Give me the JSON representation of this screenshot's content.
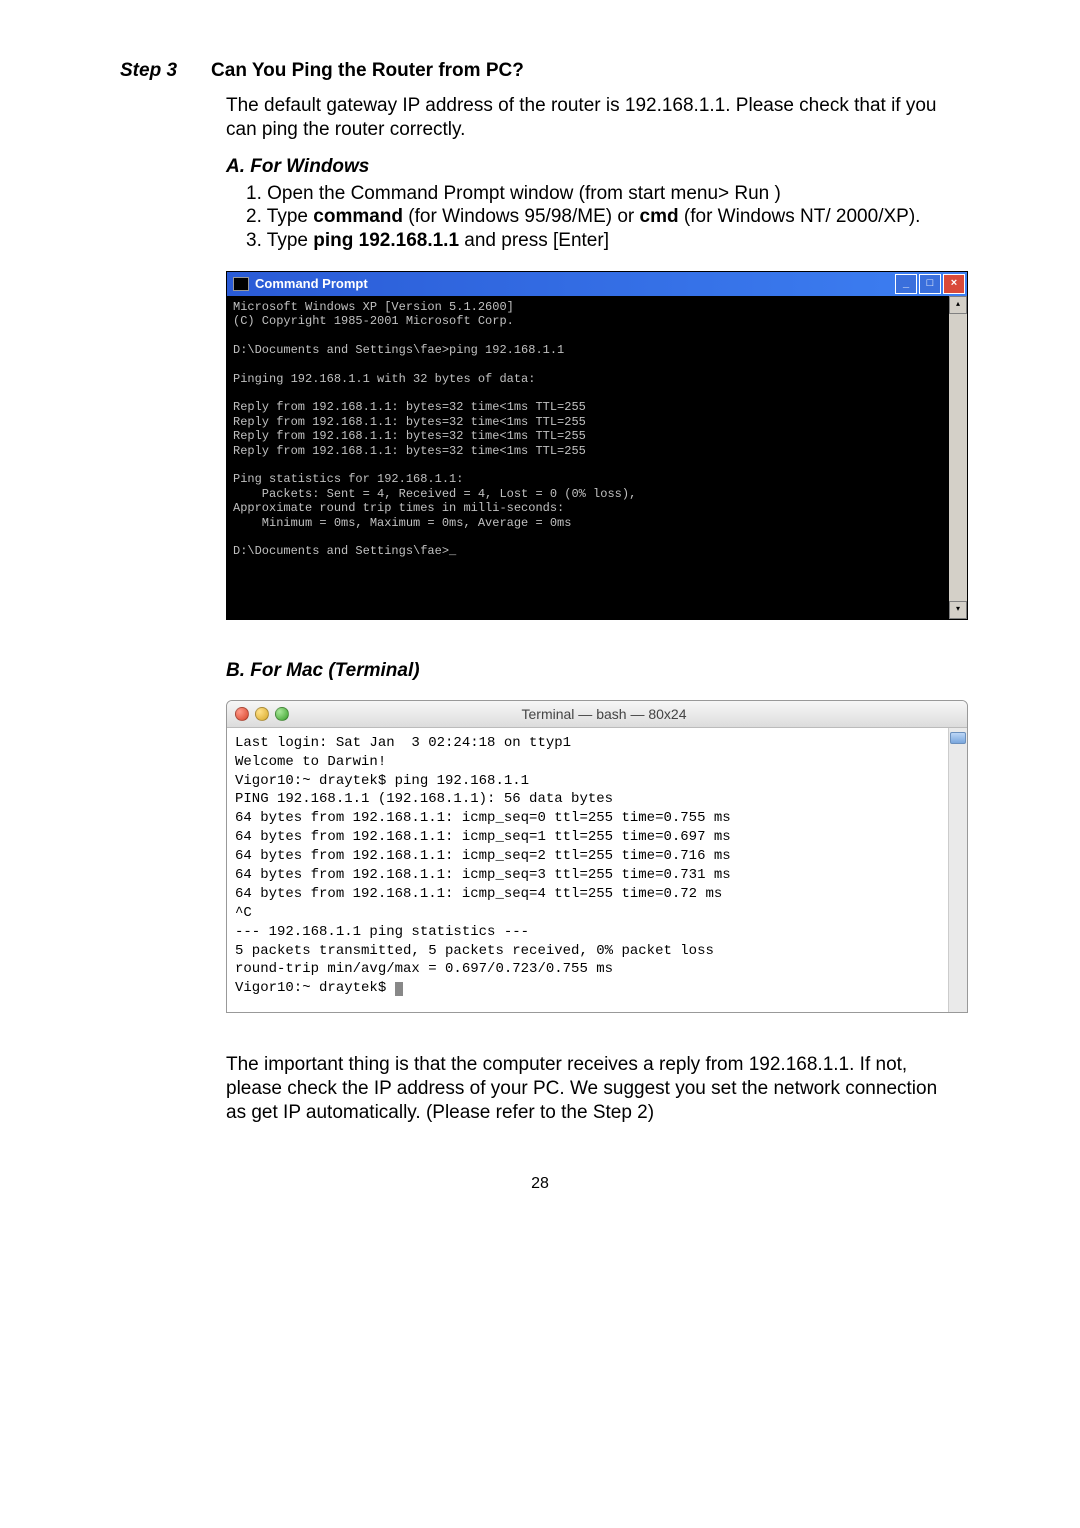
{
  "step_label": "Step 3",
  "step_heading": "Can You Ping the Router from PC?",
  "intro": "The default gateway IP address of the router is 192.168.1.1. Please check that if you can ping the router correctly.",
  "sectionA_title": "A. For Windows",
  "listA": {
    "l1": "1. Open the Command Prompt window (from start menu> Run )",
    "l2a": "2. Type ",
    "l2b": "command",
    "l2c": " (for Windows 95/98/ME) or ",
    "l2d": "cmd",
    "l2e": " (for Windows NT/ 2000/XP).",
    "l3a": "3. Type ",
    "l3b": "ping 192.168.1.1",
    "l3c": " and press [Enter]"
  },
  "win": {
    "title": "Command Prompt",
    "min": "_",
    "max": "□",
    "close": "×",
    "body": "Microsoft Windows XP [Version 5.1.2600]\n(C) Copyright 1985-2001 Microsoft Corp.\n\nD:\\Documents and Settings\\fae>ping 192.168.1.1\n\nPinging 192.168.1.1 with 32 bytes of data:\n\nReply from 192.168.1.1: bytes=32 time<1ms TTL=255\nReply from 192.168.1.1: bytes=32 time<1ms TTL=255\nReply from 192.168.1.1: bytes=32 time<1ms TTL=255\nReply from 192.168.1.1: bytes=32 time<1ms TTL=255\n\nPing statistics for 192.168.1.1:\n    Packets: Sent = 4, Received = 4, Lost = 0 (0% loss),\nApproximate round trip times in milli-seconds:\n    Minimum = 0ms, Maximum = 0ms, Average = 0ms\n\nD:\\Documents and Settings\\fae>_"
  },
  "sectionB_title": "B. For Mac (Terminal)",
  "mac": {
    "title": "Terminal — bash — 80x24",
    "body": "Last login: Sat Jan  3 02:24:18 on ttyp1\nWelcome to Darwin!\nVigor10:~ draytek$ ping 192.168.1.1\nPING 192.168.1.1 (192.168.1.1): 56 data bytes\n64 bytes from 192.168.1.1: icmp_seq=0 ttl=255 time=0.755 ms\n64 bytes from 192.168.1.1: icmp_seq=1 ttl=255 time=0.697 ms\n64 bytes from 192.168.1.1: icmp_seq=2 ttl=255 time=0.716 ms\n64 bytes from 192.168.1.1: icmp_seq=3 ttl=255 time=0.731 ms\n64 bytes from 192.168.1.1: icmp_seq=4 ttl=255 time=0.72 ms\n^C\n--- 192.168.1.1 ping statistics ---\n5 packets transmitted, 5 packets received, 0% packet loss\nround-trip min/avg/max = 0.697/0.723/0.755 ms\nVigor10:~ draytek$ "
  },
  "closing": "The important thing is that the computer receives a reply from 192.168.1.1. If not, please check the IP address of your PC. We suggest you set the network connection as get IP automatically. (Please refer to the Step 2)",
  "page_number": "28"
}
